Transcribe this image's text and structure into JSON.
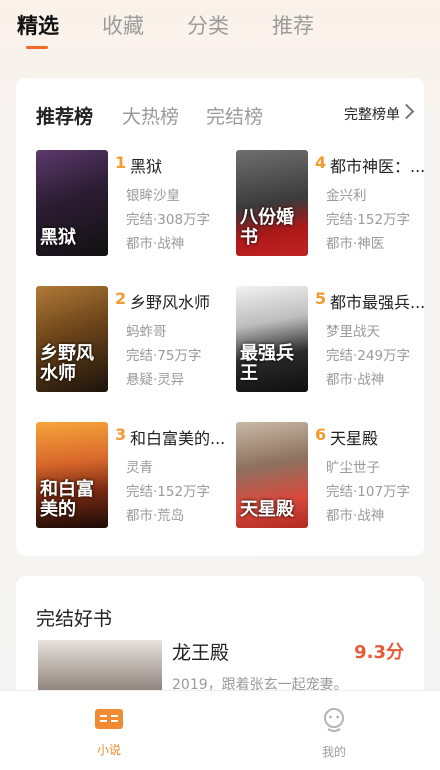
{
  "top_tabs": [
    {
      "label": "精选",
      "active": true
    },
    {
      "label": "收藏",
      "active": false
    },
    {
      "label": "分类",
      "active": false
    },
    {
      "label": "推荐",
      "active": false
    }
  ],
  "rank": {
    "tabs": [
      {
        "label": "推荐榜",
        "active": true
      },
      {
        "label": "大热榜",
        "active": false
      },
      {
        "label": "完结榜",
        "active": false
      }
    ],
    "full_list_label": "完整榜单",
    "books": [
      {
        "no": "1",
        "title": "黑狱",
        "author": "银眸沙皇",
        "status": "完结·308万字",
        "tags": "都市·战神",
        "cover_text": "黑狱"
      },
      {
        "no": "4",
        "title": "都市神医：...",
        "author": "金兴利",
        "status": "完结·152万字",
        "tags": "都市·神医",
        "cover_text": "八份婚书"
      },
      {
        "no": "2",
        "title": "乡野风水师",
        "author": "蚂蚱哥",
        "status": "完结·75万字",
        "tags": "悬疑·灵异",
        "cover_text": "乡野风水师"
      },
      {
        "no": "5",
        "title": "都市最强兵...",
        "author": "梦里战天",
        "status": "完结·249万字",
        "tags": "都市·战神",
        "cover_text": "最强兵王"
      },
      {
        "no": "3",
        "title": "和白富美的...",
        "author": "灵青",
        "status": "完结·152万字",
        "tags": "都市·荒岛",
        "cover_text": "和白富美的"
      },
      {
        "no": "6",
        "title": "天星殿",
        "author": "旷尘世子",
        "status": "完结·107万字",
        "tags": "都市·战神",
        "cover_text": "天星殿"
      }
    ]
  },
  "finished": {
    "title": "完结好书",
    "book_title": "龙王殿",
    "score": "9.3分",
    "desc": "2019，跟着张玄一起宠妻。"
  },
  "nav": {
    "items": [
      {
        "label": "小说",
        "active": true,
        "icon": "book-icon"
      },
      {
        "label": "我的",
        "active": false,
        "icon": "profile-icon"
      }
    ]
  },
  "colors": {
    "accent": "#f06a25",
    "rank_number": "#f39a31",
    "score": "#e45b36",
    "nav_active": "#f08a33",
    "nav_inactive": "#b5b5b5"
  }
}
